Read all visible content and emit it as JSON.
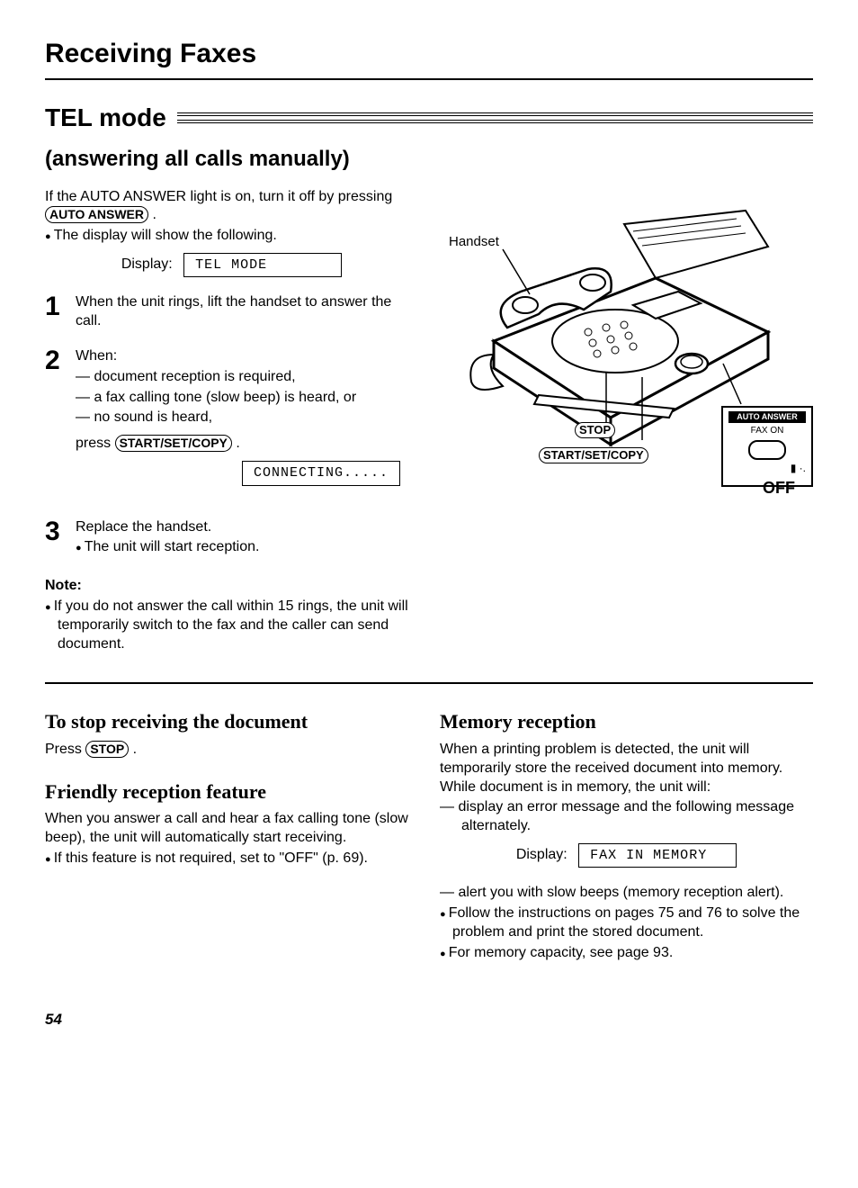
{
  "page_title": "Receiving Faxes",
  "mode_title": "TEL mode",
  "subtitle": "(answering all calls manually)",
  "intro_line1": "If the AUTO ANSWER light is on, turn it off by pressing",
  "auto_answer_btn": "AUTO ANSWER",
  "intro_bullet": "The display will show the following.",
  "display_label": "Display:",
  "display1": "TEL MODE",
  "display2": "CONNECTING.....",
  "display3": "FAX IN MEMORY",
  "steps": {
    "1": "When the unit rings, lift the handset to answer the call.",
    "2_lead": "When:",
    "2a": "— document reception is required,",
    "2b": "— a fax calling tone (slow beep) is heard, or",
    "2c": "— no sound is heard,",
    "2_press": "press ",
    "start_btn": "START/SET/COPY",
    "3a": "Replace the handset.",
    "3b": "The unit will start reception."
  },
  "note_heading": "Note:",
  "note_text": "If you do not answer the call within 15 rings, the unit will temporarily switch to the fax and the caller can send document.",
  "figure": {
    "handset": "Handset",
    "stop": "STOP",
    "startset": "START/SET/COPY",
    "auto_answer": "AUTO ANSWER",
    "fax_on": "FAX ON",
    "off": "OFF"
  },
  "stop_heading": "To stop receiving the document",
  "stop_text": "Press ",
  "stop_btn": "STOP",
  "friendly_heading": "Friendly reception feature",
  "friendly_text": "When you answer a call and hear a fax calling tone (slow beep), the unit will automatically start receiving.",
  "friendly_bullet": "If this feature is not required, set to \"OFF\" (p. 69).",
  "memory_heading": "Memory reception",
  "memory_p1": "When a printing problem is detected, the unit will temporarily store the received document into memory.",
  "memory_p2": "While document is in memory, the unit will:",
  "memory_dash1": "— display an error message and the following message alternately.",
  "memory_dash2": "— alert you with slow beeps (memory reception alert).",
  "memory_b1": "Follow the instructions on pages 75 and 76 to solve the problem and print the stored document.",
  "memory_b2": "For memory capacity, see page 93.",
  "page_number": "54"
}
